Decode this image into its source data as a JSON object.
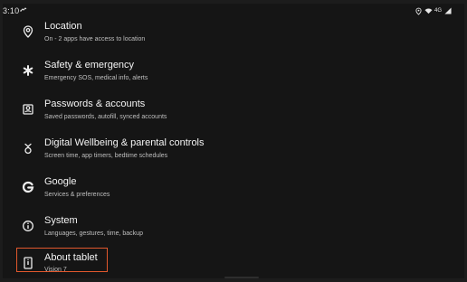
{
  "status_bar": {
    "time": "3:10",
    "network": "4G"
  },
  "settings": [
    {
      "title": "Location",
      "subtitle": "On - 2 apps have access to location",
      "icon": "location-icon"
    },
    {
      "title": "Safety & emergency",
      "subtitle": "Emergency SOS, medical info, alerts",
      "icon": "asterisk-icon"
    },
    {
      "title": "Passwords & accounts",
      "subtitle": "Saved passwords, autofill, synced accounts",
      "icon": "account-box-icon"
    },
    {
      "title": "Digital Wellbeing & parental controls",
      "subtitle": "Screen time, app timers, bedtime schedules",
      "icon": "wellbeing-icon"
    },
    {
      "title": "Google",
      "subtitle": "Services & preferences",
      "icon": "google-icon"
    },
    {
      "title": "System",
      "subtitle": "Languages, gestures, time, backup",
      "icon": "info-icon"
    },
    {
      "title": "About tablet",
      "subtitle": "Vision 7",
      "icon": "tablet-icon"
    }
  ],
  "colors": {
    "background": "#151515",
    "text_primary": "#f4f4f4",
    "text_secondary": "#bfbfbf",
    "highlight": "#e1582d"
  }
}
